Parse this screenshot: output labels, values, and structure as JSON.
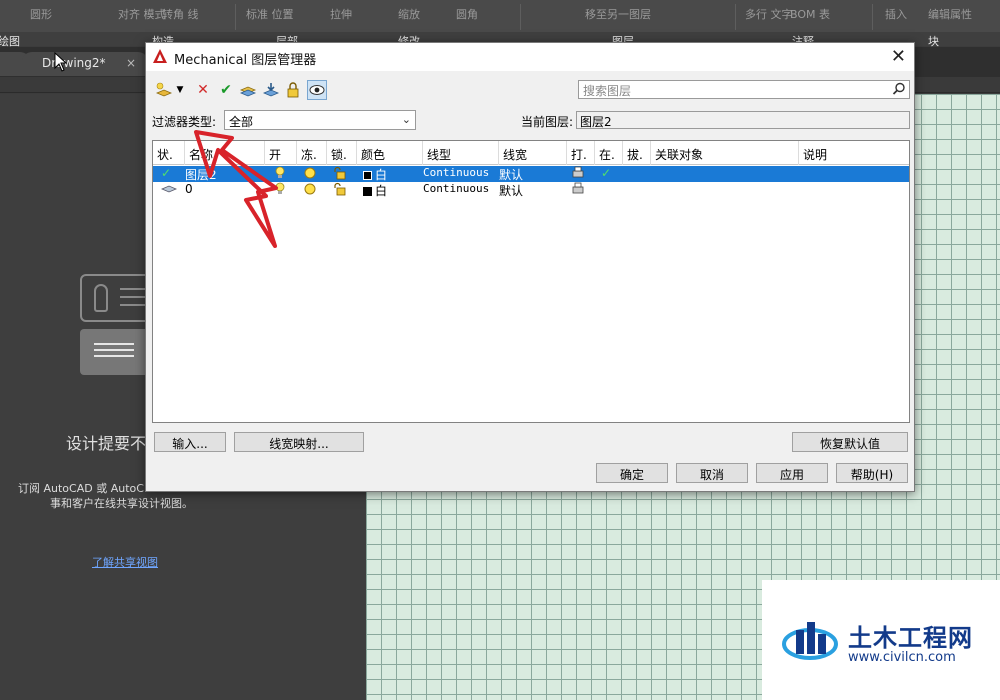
{
  "ribbon": {
    "tools": [
      "圆形",
      "对齐\n模式",
      "转角\n线",
      "标准\n位置",
      "拉伸",
      "缩放",
      "圆角",
      "移至另一图层",
      "多行\n文字",
      "BOM 表",
      "插入",
      "编辑属性"
    ],
    "groups": [
      "绘图",
      "构造",
      "层部",
      "修改",
      "图层",
      "注释",
      "块"
    ]
  },
  "tabs": {
    "active_tab": "Drawing2*",
    "close_glyph": "×"
  },
  "start_panel": {
    "title": "设计提要不",
    "desc_line1": "订阅 AutoCAD 或 AutoC",
    "desc_line2": "事和客户在线共享设计视图。",
    "link": "了解共享视图"
  },
  "dialog": {
    "title": "Mechanical 图层管理器",
    "search_placeholder": "搜索图层",
    "filter_label": "过滤器类型:",
    "filter_value": "全部",
    "current_layer_label": "当前图层:",
    "current_layer_value": "图层2",
    "columns": [
      "状.",
      "名称",
      "开",
      "冻.",
      "锁.",
      "颜色",
      "线型",
      "线宽",
      "打.",
      "在.",
      "拔.",
      "关联对象",
      "说明"
    ],
    "rows": [
      {
        "status": "✓",
        "name": "图层2",
        "color": "白",
        "linetype": "Continuous",
        "lineweight": "默认",
        "inuse": "✓",
        "selected": true
      },
      {
        "status": "",
        "name": "0",
        "color": "白",
        "linetype": "Continuous",
        "lineweight": "默认",
        "inuse": "",
        "selected": false
      }
    ],
    "buttons": {
      "import": "输入...",
      "lineweight_map": "线宽映射...",
      "restore_default": "恢复默认值",
      "ok": "确定",
      "cancel": "取消",
      "apply": "应用",
      "help": "帮助(H)"
    },
    "toolbar_icons": [
      "new-layer-icon",
      "dropdown-arrow-icon",
      "delete-layer-icon",
      "set-current-icon",
      "layer-states-icon",
      "layer-walk-icon",
      "lock-layer-icon",
      "visibility-eye-icon"
    ]
  },
  "watermark": {
    "name": "土木工程网",
    "url": "www.civilcn.com"
  },
  "colors": {
    "selection": "#1a7ad6",
    "annotation_arrow": "#d8232a",
    "drawing_bg": "#d9ebdf",
    "watermark_text": "#123a8a"
  }
}
